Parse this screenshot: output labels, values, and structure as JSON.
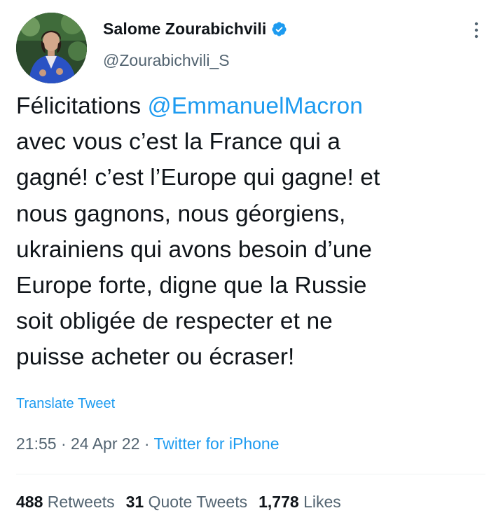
{
  "author": {
    "display_name": "Salome Zourabichvili",
    "handle": "@Zourabichvili_S",
    "verified": true,
    "avatar": "profile-photo"
  },
  "tweet": {
    "text_before_mention": "Félicitations ",
    "mention": "@EmmanuelMacron",
    "text_after_mention": "\navec vous c’est la France qui a\ngagné! c’est l’Europe qui gagne! et\nnous gagnons, nous géorgiens,\nukrainiens qui avons besoin d’une\nEurope forte, digne  que la Russie\nsoit obligée de respecter et ne\npuisse acheter ou écraser!",
    "translate_label": "Translate Tweet",
    "time": "21:55",
    "separator": " · ",
    "date": "24 Apr 22",
    "source": "Twitter for iPhone"
  },
  "stats": {
    "retweets_count": "488",
    "retweets_label": " Retweets",
    "quote_count": "31",
    "quote_label": " Quote Tweets",
    "likes_count": "1,778",
    "likes_label": " Likes"
  },
  "icons": {
    "verified": "verified-badge-icon",
    "more": "more-options-icon"
  },
  "colors": {
    "accent": "#1d9bf0",
    "text": "#0f1419",
    "secondary": "#536471"
  }
}
